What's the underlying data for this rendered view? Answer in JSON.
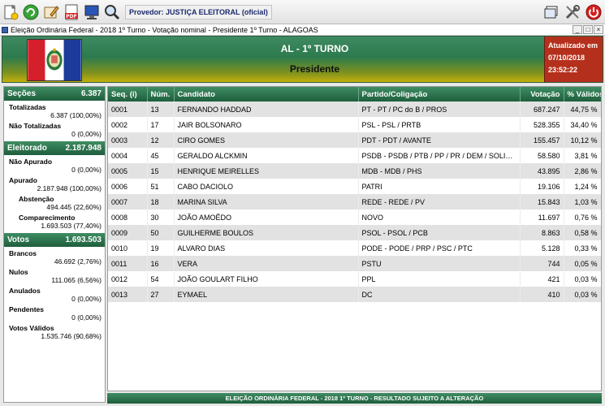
{
  "toolbar": {
    "provider_label": "Provedor: JUSTIÇA ELEITORAL (oficial)",
    "left_icons": [
      "new-document-icon",
      "refresh-icon",
      "edit-icon",
      "pdf-icon",
      "monitor-icon",
      "search-icon"
    ],
    "right_icons": [
      "window-icon",
      "tools-icon",
      "power-icon"
    ]
  },
  "window": {
    "title": "Eleição Ordinária Federal - 2018 1º Turno - Votação nominal - Presidente 1º Turno - ALAGOAS",
    "controls": [
      "_",
      "□",
      "×"
    ]
  },
  "header": {
    "title": "AL - 1º TURNO",
    "subtitle": "Presidente",
    "update_label": "Atualizado em",
    "update_date": "07/10/2018",
    "update_time": "23:52:22",
    "colors": {
      "green": "#2c7a4e",
      "yellow": "#c3b00c",
      "update_bg": "#b5301c"
    }
  },
  "summary": {
    "secoes": {
      "label": "Seções",
      "total": "6.387",
      "totalizadas_label": "Totalizadas",
      "totalizadas_value": "6.387 (100,00%)",
      "nao_totalizadas_label": "Não Totalizadas",
      "nao_totalizadas_value": "0 (0,00%)"
    },
    "eleitorado": {
      "label": "Eleitorado",
      "total": "2.187.948",
      "nao_apurado_label": "Não Apurado",
      "nao_apurado_value": "0 (0,00%)",
      "apurado_label": "Apurado",
      "apurado_value": "2.187.948 (100,00%)",
      "abstencao_label": "Abstenção",
      "abstencao_value": "494.445 (22,60%)",
      "comparecimento_label": "Comparecimento",
      "comparecimento_value": "1.693.503 (77,40%)"
    },
    "votos": {
      "label": "Votos",
      "total": "1.693.503",
      "brancos_label": "Brancos",
      "brancos_value": "46.692 (2,76%)",
      "nulos_label": "Nulos",
      "nulos_value": "111.065 (6,56%)",
      "anulados_label": "Anulados",
      "anulados_value": "0 (0,00%)",
      "pendentes_label": "Pendentes",
      "pendentes_value": "0 (0,00%)",
      "validos_label": "Votos Válidos",
      "validos_value": "1.535.746 (90,68%)"
    }
  },
  "table": {
    "headers": {
      "seq": "Seq.  (i)",
      "num": "Núm.",
      "candidato": "Candidato",
      "partido": "Partido/Coligação",
      "votacao": "Votação",
      "pct": "% Válidos"
    },
    "rows": [
      {
        "seq": "0001",
        "num": "13",
        "candidato": "FERNANDO HADDAD",
        "partido": "PT - PT / PC do B / PROS",
        "votacao": "687.247",
        "pct": "44,75 %"
      },
      {
        "seq": "0002",
        "num": "17",
        "candidato": "JAIR BOLSONARO",
        "partido": "PSL - PSL / PRTB",
        "votacao": "528.355",
        "pct": "34,40 %"
      },
      {
        "seq": "0003",
        "num": "12",
        "candidato": "CIRO GOMES",
        "partido": "PDT - PDT / AVANTE",
        "votacao": "155.457",
        "pct": "10,12 %"
      },
      {
        "seq": "0004",
        "num": "45",
        "candidato": "GERALDO ALCKMIN",
        "partido": "PSDB - PSDB / PTB / PP / PR / DEM / SOLIDARIEDADE ...",
        "votacao": "58.580",
        "pct": "3,81 %"
      },
      {
        "seq": "0005",
        "num": "15",
        "candidato": "HENRIQUE MEIRELLES",
        "partido": "MDB - MDB / PHS",
        "votacao": "43.895",
        "pct": "2,86 %"
      },
      {
        "seq": "0006",
        "num": "51",
        "candidato": "CABO DACIOLO",
        "partido": "PATRI",
        "votacao": "19.106",
        "pct": "1,24 %"
      },
      {
        "seq": "0007",
        "num": "18",
        "candidato": "MARINA SILVA",
        "partido": "REDE - REDE / PV",
        "votacao": "15.843",
        "pct": "1,03 %"
      },
      {
        "seq": "0008",
        "num": "30",
        "candidato": "JOÃO AMOÊDO",
        "partido": "NOVO",
        "votacao": "11.697",
        "pct": "0,76 %"
      },
      {
        "seq": "0009",
        "num": "50",
        "candidato": "GUILHERME BOULOS",
        "partido": "PSOL - PSOL / PCB",
        "votacao": "8.863",
        "pct": "0,58 %"
      },
      {
        "seq": "0010",
        "num": "19",
        "candidato": "ALVARO DIAS",
        "partido": "PODE - PODE / PRP / PSC / PTC",
        "votacao": "5.128",
        "pct": "0,33 %"
      },
      {
        "seq": "0011",
        "num": "16",
        "candidato": "VERA",
        "partido": "PSTU",
        "votacao": "744",
        "pct": "0,05 %"
      },
      {
        "seq": "0012",
        "num": "54",
        "candidato": "JOÃO GOULART FILHO",
        "partido": "PPL",
        "votacao": "421",
        "pct": "0,03 %"
      },
      {
        "seq": "0013",
        "num": "27",
        "candidato": "EYMAEL",
        "partido": "DC",
        "votacao": "410",
        "pct": "0,03 %"
      }
    ]
  },
  "footer": {
    "text": "ELEIÇÃO ORDINÁRIA FEDERAL - 2018 1º TURNO - RESULTADO SUJEITO A ALTERAÇÃO"
  }
}
